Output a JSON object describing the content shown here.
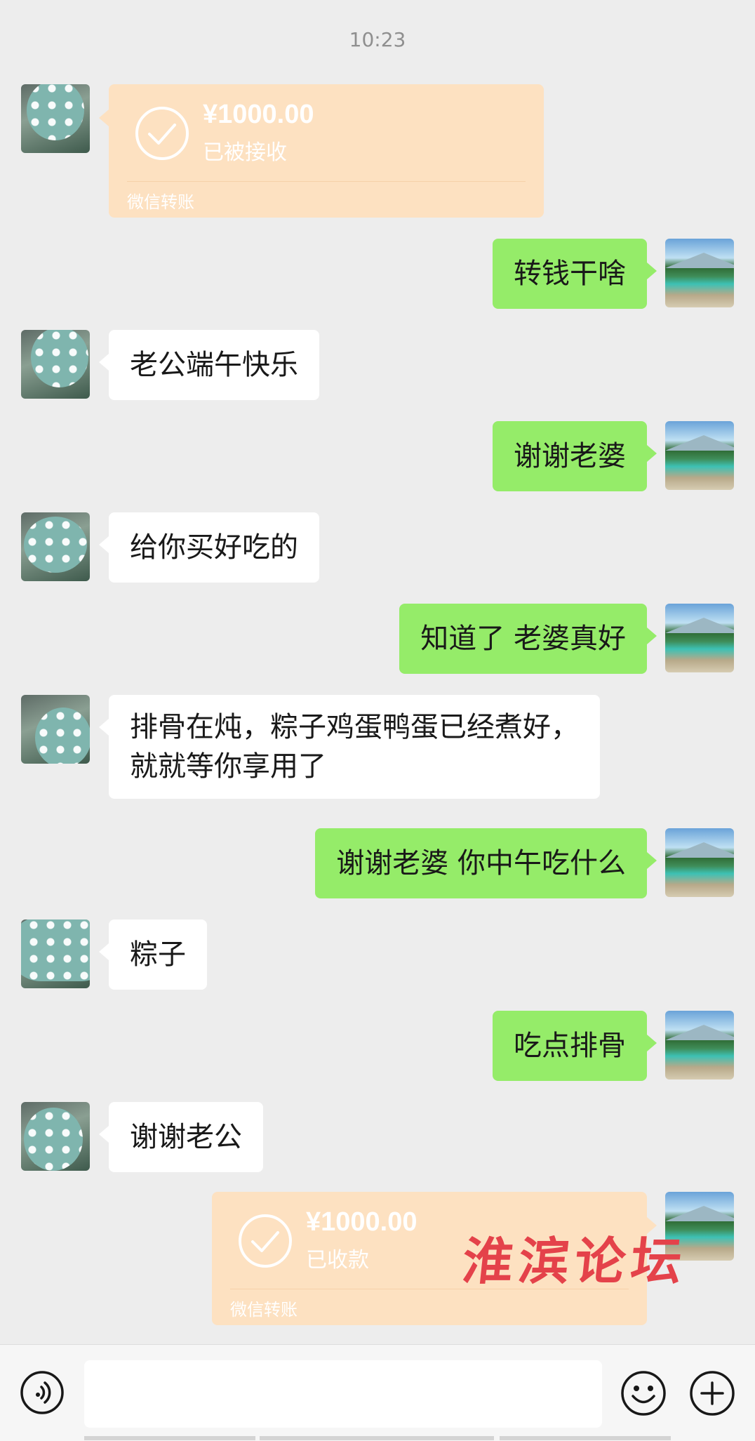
{
  "status": {
    "time": "10:23"
  },
  "messages": {
    "m1": {
      "amount": "¥1000.00",
      "status": "已被接收",
      "label": "微信转账"
    },
    "m2": {
      "text": "转钱干啥"
    },
    "m3": {
      "text": "老公端午快乐"
    },
    "m4": {
      "text": "谢谢老婆"
    },
    "m5": {
      "text": "给你买好吃的"
    },
    "m6": {
      "text": "知道了 老婆真好"
    },
    "m7": {
      "text": "排骨在炖，粽子鸡蛋鸭蛋已经煮好，就就等你享用了"
    },
    "m8": {
      "text": "谢谢老婆 你中午吃什么"
    },
    "m9": {
      "text": "粽子"
    },
    "m10": {
      "text": "吃点排骨"
    },
    "m11": {
      "text": "谢谢老公"
    },
    "m12": {
      "amount": "¥1000.00",
      "status": "已收款",
      "label": "微信转账"
    }
  },
  "watermark": "淮滨论坛",
  "input": {
    "placeholder": ""
  },
  "icons": {
    "voice": "voice-icon",
    "emoji": "emoji-icon",
    "plus": "plus-icon",
    "check": "check-circle-icon"
  },
  "colors": {
    "background": "#ededed",
    "outgoing_bubble": "#95ec69",
    "incoming_bubble": "#ffffff",
    "transfer_card": "#fde1c1",
    "watermark": "#e4424a"
  }
}
